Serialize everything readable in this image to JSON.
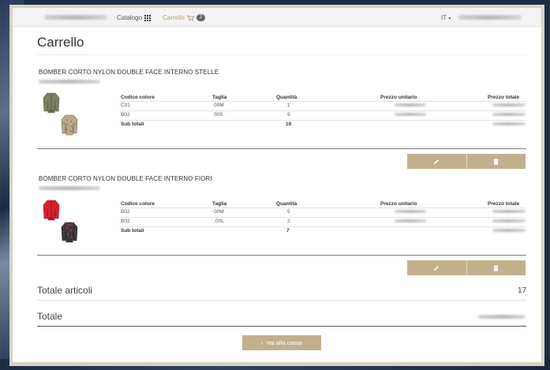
{
  "nav": {
    "catalog_label": "Catalogo",
    "cart_label": "Carrello",
    "cart_count": "2",
    "language": "IT"
  },
  "page": {
    "title": "Carrello"
  },
  "columns": {
    "color_code": "Codice colore",
    "size": "Taglia",
    "quantity": "Quantità",
    "unit_price": "Prezzo unitario",
    "total_price": "Prezzo totale"
  },
  "products": [
    {
      "name": "BOMBER CORTO NYLON DOUBLE FACE INTERNO STELLE",
      "rows": [
        {
          "color": "C01",
          "size": "00M",
          "qty": "1"
        },
        {
          "color": "B02",
          "size": "00S",
          "qty": "9"
        }
      ],
      "subtotal_label": "Sub totali",
      "subtotal_qty": "10"
    },
    {
      "name": "BOMBER CORTO NYLON DOUBLE FACE INTERNO FIORI",
      "rows": [
        {
          "color": "B02",
          "size": "00M",
          "qty": "5"
        },
        {
          "color": "B02",
          "size": "00L",
          "qty": "2"
        }
      ],
      "subtotal_label": "Sub totali",
      "subtotal_qty": "7"
    }
  ],
  "summary": {
    "items_label": "Totale articoli",
    "items_value": "17",
    "total_label": "Totale"
  },
  "checkout": {
    "label": "Vai alla cassa"
  },
  "icons": {
    "edit": "pencil-icon",
    "delete": "trash-icon",
    "catalog": "grid-icon",
    "cart": "cart-icon",
    "checkout": "chevron-right-icon"
  },
  "colors": {
    "accent": "#c2b08c",
    "cart_link": "#b59f76",
    "frame": "#d7d3c4"
  }
}
